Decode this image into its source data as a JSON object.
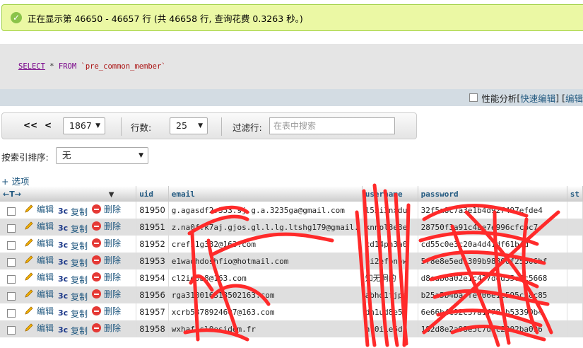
{
  "success_message": "正在显示第 46650 - 46657 行 (共 46658 行, 查询花费 0.3263 秒。)",
  "sql": {
    "select": "SELECT",
    "rest1": " * ",
    "from": "FROM",
    "table": " `pre_common_member`"
  },
  "options_bar": {
    "profiling": "性能分析",
    "bracket_open": " [ ",
    "quick_edit": "快速编辑",
    "bracket_close": " ] [ ",
    "edit": "编辑"
  },
  "nav": {
    "first": "<<",
    "prev": "<",
    "page_value": "1867",
    "rows_label": "行数:",
    "rows_value": "25",
    "filter_label": "过滤行:",
    "filter_placeholder": "在表中搜索"
  },
  "sort": {
    "label": "按索引排序:",
    "value": "无"
  },
  "options_link": "+ 选项",
  "table": {
    "arrows": "←T→",
    "columns": [
      "uid",
      "email",
      "username",
      "password",
      "st"
    ],
    "actions": {
      "edit": "编辑",
      "copy": "复制",
      "delete": "删除"
    },
    "rows": [
      {
        "uid": "81950",
        "email": "g.agasdf2.353.sj.g.a.3235ga@gmail.com",
        "username": "l5xi3nxdu",
        "password": "32f5a8c7a3e1b4d927497efde4"
      },
      {
        "uid": "81951",
        "email": "z.na0f.k7aj.gjos.gl.l.lg.ltshg179@gmail.",
        "username": "knnpl3e3e",
        "password": "28750f3a91c4be7e996cfcbc7"
      },
      {
        "uid": "81952",
        "email": "crefi1g332@163.com",
        "username": "cd14pn3a0",
        "password": "cd55c0e3c20a4d41df61b4d"
      },
      {
        "uid": "81953",
        "email": "e1waohdoshfio@hotmail.com",
        "username": "oi2efonow",
        "password": "5f8e8e5ed1309b98800f25306bf"
      },
      {
        "uid": "81954",
        "email": "cl2ig0b8@163.com",
        "username": "知无洞的",
        "password": "d8eab6a02e1c437ded35e8c5668"
      },
      {
        "uid": "81956",
        "email": "rga310016313502163.com",
        "username": "abhd1fjpe",
        "password": "b25a5b4ba3fe006e1c595c38c85"
      },
      {
        "uid": "81957",
        "email": "xcrb5378924607@163.com",
        "username": "dh1ud8e5f",
        "password": "6e66b4c92c37a1f781b53390b4"
      },
      {
        "uid": "81958",
        "email": "wxhaf1sl0esidem.fr",
        "username": "nf0i1e6d3",
        "password": "182d8e2a98e5c7d3c2202ba096"
      }
    ]
  },
  "colors": {
    "success_bg": "#ebf8a4",
    "link": "#235a81",
    "header_bar": "#d3dce3",
    "scribble": "#ff2a2a"
  }
}
